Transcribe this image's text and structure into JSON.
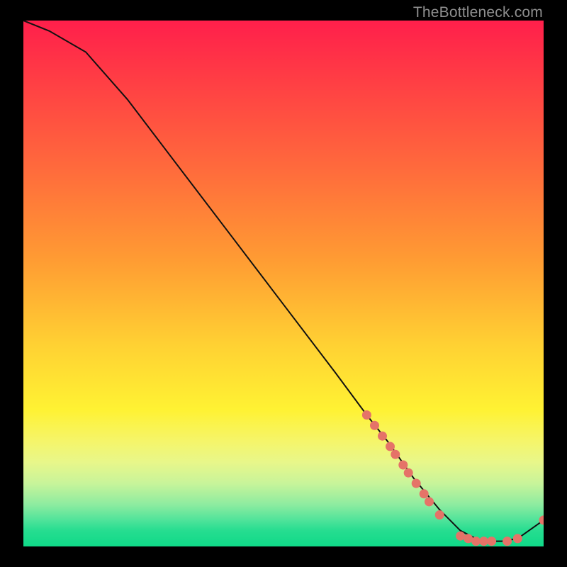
{
  "watermark": "TheBottleneck.com",
  "colors": {
    "curve_stroke": "#111111",
    "point_fill": "#e57368",
    "point_stroke": "#e57368"
  },
  "plot": {
    "viewbox_w": 734,
    "viewbox_h": 742,
    "point_radius": 6
  },
  "chart_data": {
    "type": "line",
    "title": "",
    "xlabel": "",
    "ylabel": "",
    "xlim": [
      0,
      100
    ],
    "ylim": [
      0,
      100
    ],
    "grid": false,
    "legend": false,
    "series": [
      {
        "name": "curve",
        "x": [
          0,
          5,
          12,
          20,
          30,
          40,
          50,
          60,
          66,
          70,
          75,
          80,
          84,
          88,
          92,
          95,
          100
        ],
        "y": [
          100,
          98,
          94,
          85,
          72,
          59,
          46,
          33,
          25,
          20,
          13,
          7,
          3,
          1,
          1,
          1.5,
          5
        ]
      }
    ],
    "scatter_points": [
      {
        "x": 66,
        "y": 25
      },
      {
        "x": 67.5,
        "y": 23
      },
      {
        "x": 69,
        "y": 21
      },
      {
        "x": 70.5,
        "y": 19
      },
      {
        "x": 71.5,
        "y": 17.5
      },
      {
        "x": 73,
        "y": 15.5
      },
      {
        "x": 74,
        "y": 14
      },
      {
        "x": 75.5,
        "y": 12
      },
      {
        "x": 77,
        "y": 10
      },
      {
        "x": 78,
        "y": 8.5
      },
      {
        "x": 80,
        "y": 6
      },
      {
        "x": 84,
        "y": 2
      },
      {
        "x": 85.5,
        "y": 1.5
      },
      {
        "x": 87,
        "y": 1
      },
      {
        "x": 88.5,
        "y": 1
      },
      {
        "x": 90,
        "y": 1
      },
      {
        "x": 93,
        "y": 1
      },
      {
        "x": 95,
        "y": 1.5
      },
      {
        "x": 100,
        "y": 5
      }
    ]
  }
}
